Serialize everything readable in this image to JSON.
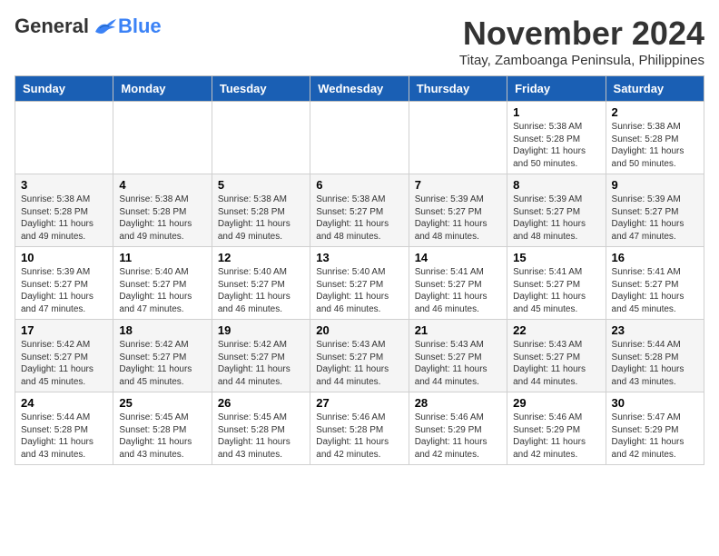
{
  "header": {
    "logo_general": "General",
    "logo_blue": "Blue",
    "month_title": "November 2024",
    "location": "Titay, Zamboanga Peninsula, Philippines"
  },
  "weekdays": [
    "Sunday",
    "Monday",
    "Tuesday",
    "Wednesday",
    "Thursday",
    "Friday",
    "Saturday"
  ],
  "weeks": [
    [
      {
        "day": "",
        "info": ""
      },
      {
        "day": "",
        "info": ""
      },
      {
        "day": "",
        "info": ""
      },
      {
        "day": "",
        "info": ""
      },
      {
        "day": "",
        "info": ""
      },
      {
        "day": "1",
        "info": "Sunrise: 5:38 AM\nSunset: 5:28 PM\nDaylight: 11 hours and 50 minutes."
      },
      {
        "day": "2",
        "info": "Sunrise: 5:38 AM\nSunset: 5:28 PM\nDaylight: 11 hours and 50 minutes."
      }
    ],
    [
      {
        "day": "3",
        "info": "Sunrise: 5:38 AM\nSunset: 5:28 PM\nDaylight: 11 hours and 49 minutes."
      },
      {
        "day": "4",
        "info": "Sunrise: 5:38 AM\nSunset: 5:28 PM\nDaylight: 11 hours and 49 minutes."
      },
      {
        "day": "5",
        "info": "Sunrise: 5:38 AM\nSunset: 5:28 PM\nDaylight: 11 hours and 49 minutes."
      },
      {
        "day": "6",
        "info": "Sunrise: 5:38 AM\nSunset: 5:27 PM\nDaylight: 11 hours and 48 minutes."
      },
      {
        "day": "7",
        "info": "Sunrise: 5:39 AM\nSunset: 5:27 PM\nDaylight: 11 hours and 48 minutes."
      },
      {
        "day": "8",
        "info": "Sunrise: 5:39 AM\nSunset: 5:27 PM\nDaylight: 11 hours and 48 minutes."
      },
      {
        "day": "9",
        "info": "Sunrise: 5:39 AM\nSunset: 5:27 PM\nDaylight: 11 hours and 47 minutes."
      }
    ],
    [
      {
        "day": "10",
        "info": "Sunrise: 5:39 AM\nSunset: 5:27 PM\nDaylight: 11 hours and 47 minutes."
      },
      {
        "day": "11",
        "info": "Sunrise: 5:40 AM\nSunset: 5:27 PM\nDaylight: 11 hours and 47 minutes."
      },
      {
        "day": "12",
        "info": "Sunrise: 5:40 AM\nSunset: 5:27 PM\nDaylight: 11 hours and 46 minutes."
      },
      {
        "day": "13",
        "info": "Sunrise: 5:40 AM\nSunset: 5:27 PM\nDaylight: 11 hours and 46 minutes."
      },
      {
        "day": "14",
        "info": "Sunrise: 5:41 AM\nSunset: 5:27 PM\nDaylight: 11 hours and 46 minutes."
      },
      {
        "day": "15",
        "info": "Sunrise: 5:41 AM\nSunset: 5:27 PM\nDaylight: 11 hours and 45 minutes."
      },
      {
        "day": "16",
        "info": "Sunrise: 5:41 AM\nSunset: 5:27 PM\nDaylight: 11 hours and 45 minutes."
      }
    ],
    [
      {
        "day": "17",
        "info": "Sunrise: 5:42 AM\nSunset: 5:27 PM\nDaylight: 11 hours and 45 minutes."
      },
      {
        "day": "18",
        "info": "Sunrise: 5:42 AM\nSunset: 5:27 PM\nDaylight: 11 hours and 45 minutes."
      },
      {
        "day": "19",
        "info": "Sunrise: 5:42 AM\nSunset: 5:27 PM\nDaylight: 11 hours and 44 minutes."
      },
      {
        "day": "20",
        "info": "Sunrise: 5:43 AM\nSunset: 5:27 PM\nDaylight: 11 hours and 44 minutes."
      },
      {
        "day": "21",
        "info": "Sunrise: 5:43 AM\nSunset: 5:27 PM\nDaylight: 11 hours and 44 minutes."
      },
      {
        "day": "22",
        "info": "Sunrise: 5:43 AM\nSunset: 5:27 PM\nDaylight: 11 hours and 44 minutes."
      },
      {
        "day": "23",
        "info": "Sunrise: 5:44 AM\nSunset: 5:28 PM\nDaylight: 11 hours and 43 minutes."
      }
    ],
    [
      {
        "day": "24",
        "info": "Sunrise: 5:44 AM\nSunset: 5:28 PM\nDaylight: 11 hours and 43 minutes."
      },
      {
        "day": "25",
        "info": "Sunrise: 5:45 AM\nSunset: 5:28 PM\nDaylight: 11 hours and 43 minutes."
      },
      {
        "day": "26",
        "info": "Sunrise: 5:45 AM\nSunset: 5:28 PM\nDaylight: 11 hours and 43 minutes."
      },
      {
        "day": "27",
        "info": "Sunrise: 5:46 AM\nSunset: 5:28 PM\nDaylight: 11 hours and 42 minutes."
      },
      {
        "day": "28",
        "info": "Sunrise: 5:46 AM\nSunset: 5:29 PM\nDaylight: 11 hours and 42 minutes."
      },
      {
        "day": "29",
        "info": "Sunrise: 5:46 AM\nSunset: 5:29 PM\nDaylight: 11 hours and 42 minutes."
      },
      {
        "day": "30",
        "info": "Sunrise: 5:47 AM\nSunset: 5:29 PM\nDaylight: 11 hours and 42 minutes."
      }
    ]
  ]
}
